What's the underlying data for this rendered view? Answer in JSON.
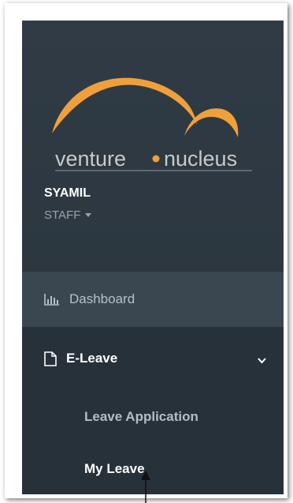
{
  "logo": {
    "word1": "venture",
    "word2": "nucleus",
    "arc_color": "#f0a03a",
    "text_color": "#c9c9c9"
  },
  "user": {
    "name": "SYAMIL",
    "role": "STAFF"
  },
  "nav": {
    "dashboard": {
      "label": "Dashboard",
      "icon": "bar-chart-icon"
    },
    "eleave": {
      "label": "E-Leave",
      "icon": "document-icon",
      "expanded": true
    },
    "sub_items": [
      {
        "label": "Leave Application"
      },
      {
        "label": "My Leave"
      }
    ]
  },
  "colors": {
    "sidebar": "#2f3a44",
    "active_bg": "#3a4650",
    "submenu_bg": "#27313a"
  }
}
